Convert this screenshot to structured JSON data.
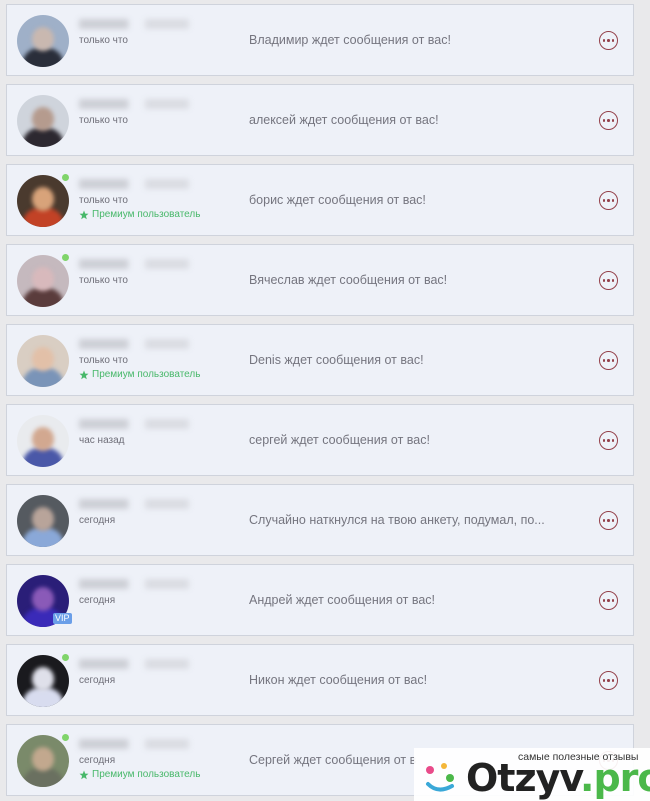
{
  "conversations": [
    {
      "time": "только что",
      "premium": "",
      "message": "Владимир ждет сообщения от вас!",
      "online": false,
      "vip": false,
      "skin": "#c9b8b0",
      "shirt": "#2a2e3a",
      "bg": "#9fb0c8"
    },
    {
      "time": "только что",
      "premium": "",
      "message": "алексей ждет сообщения от вас!",
      "online": false,
      "vip": false,
      "skin": "#b59b8e",
      "shirt": "#2c2830",
      "bg": "#cfd4dc"
    },
    {
      "time": "только что",
      "premium": "Премиум пользователь",
      "message": "борис ждет сообщения от вас!",
      "online": true,
      "vip": false,
      "skin": "#d8a37a",
      "shirt": "#c24226",
      "bg": "#4a3a2e"
    },
    {
      "time": "только что",
      "premium": "",
      "message": "Вячеслав ждет сообщения от вас!",
      "online": true,
      "vip": false,
      "skin": "#d8b9bc",
      "shirt": "#5a3c3c",
      "bg": "#c5b9be"
    },
    {
      "time": "только что",
      "premium": "Премиум пользователь",
      "message": "Denis ждет сообщения от вас!",
      "online": false,
      "vip": false,
      "skin": "#e2c0a8",
      "shirt": "#7a94b8",
      "bg": "#d9cec3"
    },
    {
      "time": "час назад",
      "premium": "",
      "message": "сергей ждет сообщения от вас!",
      "online": false,
      "vip": false,
      "skin": "#d2a890",
      "shirt": "#4a58a8",
      "bg": "#e9ebee"
    },
    {
      "time": "сегодня",
      "premium": "",
      "message": "Случайно наткнулся на твою анкету, подумал, по...",
      "online": false,
      "vip": false,
      "skin": "#b8a49a",
      "shirt": "#8aa8d8",
      "bg": "#555a60"
    },
    {
      "time": "сегодня",
      "premium": "",
      "message": "Андрей ждет сообщения от вас!",
      "online": false,
      "vip": true,
      "vip_label": "VIP",
      "skin": "#8a5ab8",
      "shirt": "#3a2ab8",
      "bg": "#2a1e78"
    },
    {
      "time": "сегодня",
      "premium": "",
      "message": "Никон ждет сообщения от вас!",
      "online": true,
      "vip": false,
      "skin": "#dfe0ea",
      "shirt": "#d8dcef",
      "bg": "#1a1a1e"
    },
    {
      "time": "сегодня",
      "premium": "Премиум пользователь",
      "message": "Сергей ждет сообщения от в",
      "online": true,
      "vip": false,
      "skin": "#c2a88e",
      "shirt": "#6a7060",
      "bg": "#7a8a6a"
    }
  ],
  "watermark": {
    "tagline": "самые полезные отзывы",
    "brand_a": "Otzyv",
    "brand_b": ".pro"
  },
  "colors": {
    "accent": "#94404a",
    "premium": "#48b86a",
    "online": "#7fd46a"
  },
  "icons": {
    "more": "more-options-icon",
    "premium": "star-icon"
  }
}
